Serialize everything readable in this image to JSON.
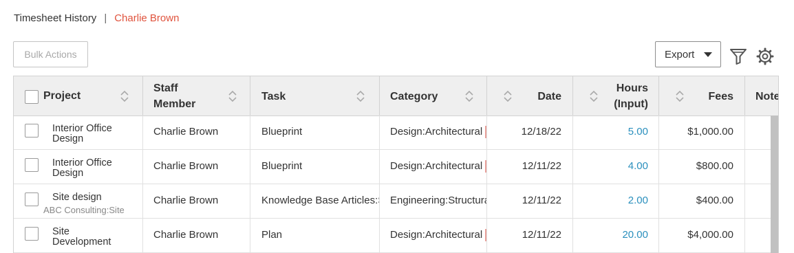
{
  "breadcrumb": {
    "root": "Timesheet History",
    "separator": "|",
    "current": "Charlie Brown"
  },
  "toolbar": {
    "bulk_actions": "Bulk Actions",
    "export": "Export"
  },
  "icons": {
    "filter": "filter-icon",
    "settings": "gear-icon"
  },
  "colors": {
    "accent_red": "#e0533d",
    "hours_blue": "#2a8fbd"
  },
  "table": {
    "headers": {
      "project": "Project",
      "staff_member_1": "Staff",
      "staff_member_2": "Member",
      "task": "Task",
      "category": "Category",
      "date": "Date",
      "hours_1": "Hours",
      "hours_2": "(Input)",
      "fees": "Fees",
      "notes": "Notes"
    },
    "rows": [
      {
        "project_line1": "Interior Office",
        "project_line2": "Design",
        "project_sub": "",
        "staff": "Charlie Brown",
        "task": "Blueprint",
        "category": "Design:Architectural",
        "date": "12/18/22",
        "hours": "5.00",
        "fees": "$1,000.00"
      },
      {
        "project_line1": "Interior Office",
        "project_line2": "Design",
        "project_sub": "",
        "staff": "Charlie Brown",
        "task": "Blueprint",
        "category": "Design:Architectural",
        "date": "12/11/22",
        "hours": "4.00",
        "fees": "$800.00"
      },
      {
        "project_line1": "Site design",
        "project_line2": "",
        "project_sub": "ABC Consulting:Site",
        "staff": "Charlie Brown",
        "task": "Knowledge Base Articles:S",
        "category": "Engineering:Structura",
        "date": "12/11/22",
        "hours": "2.00",
        "fees": "$400.00"
      },
      {
        "project_line1": "Site",
        "project_line2": "Development",
        "project_sub": "",
        "staff": "Charlie Brown",
        "task": "Plan",
        "category": "Design:Architectural",
        "date": "12/11/22",
        "hours": "20.00",
        "fees": "$4,000.00"
      }
    ]
  }
}
